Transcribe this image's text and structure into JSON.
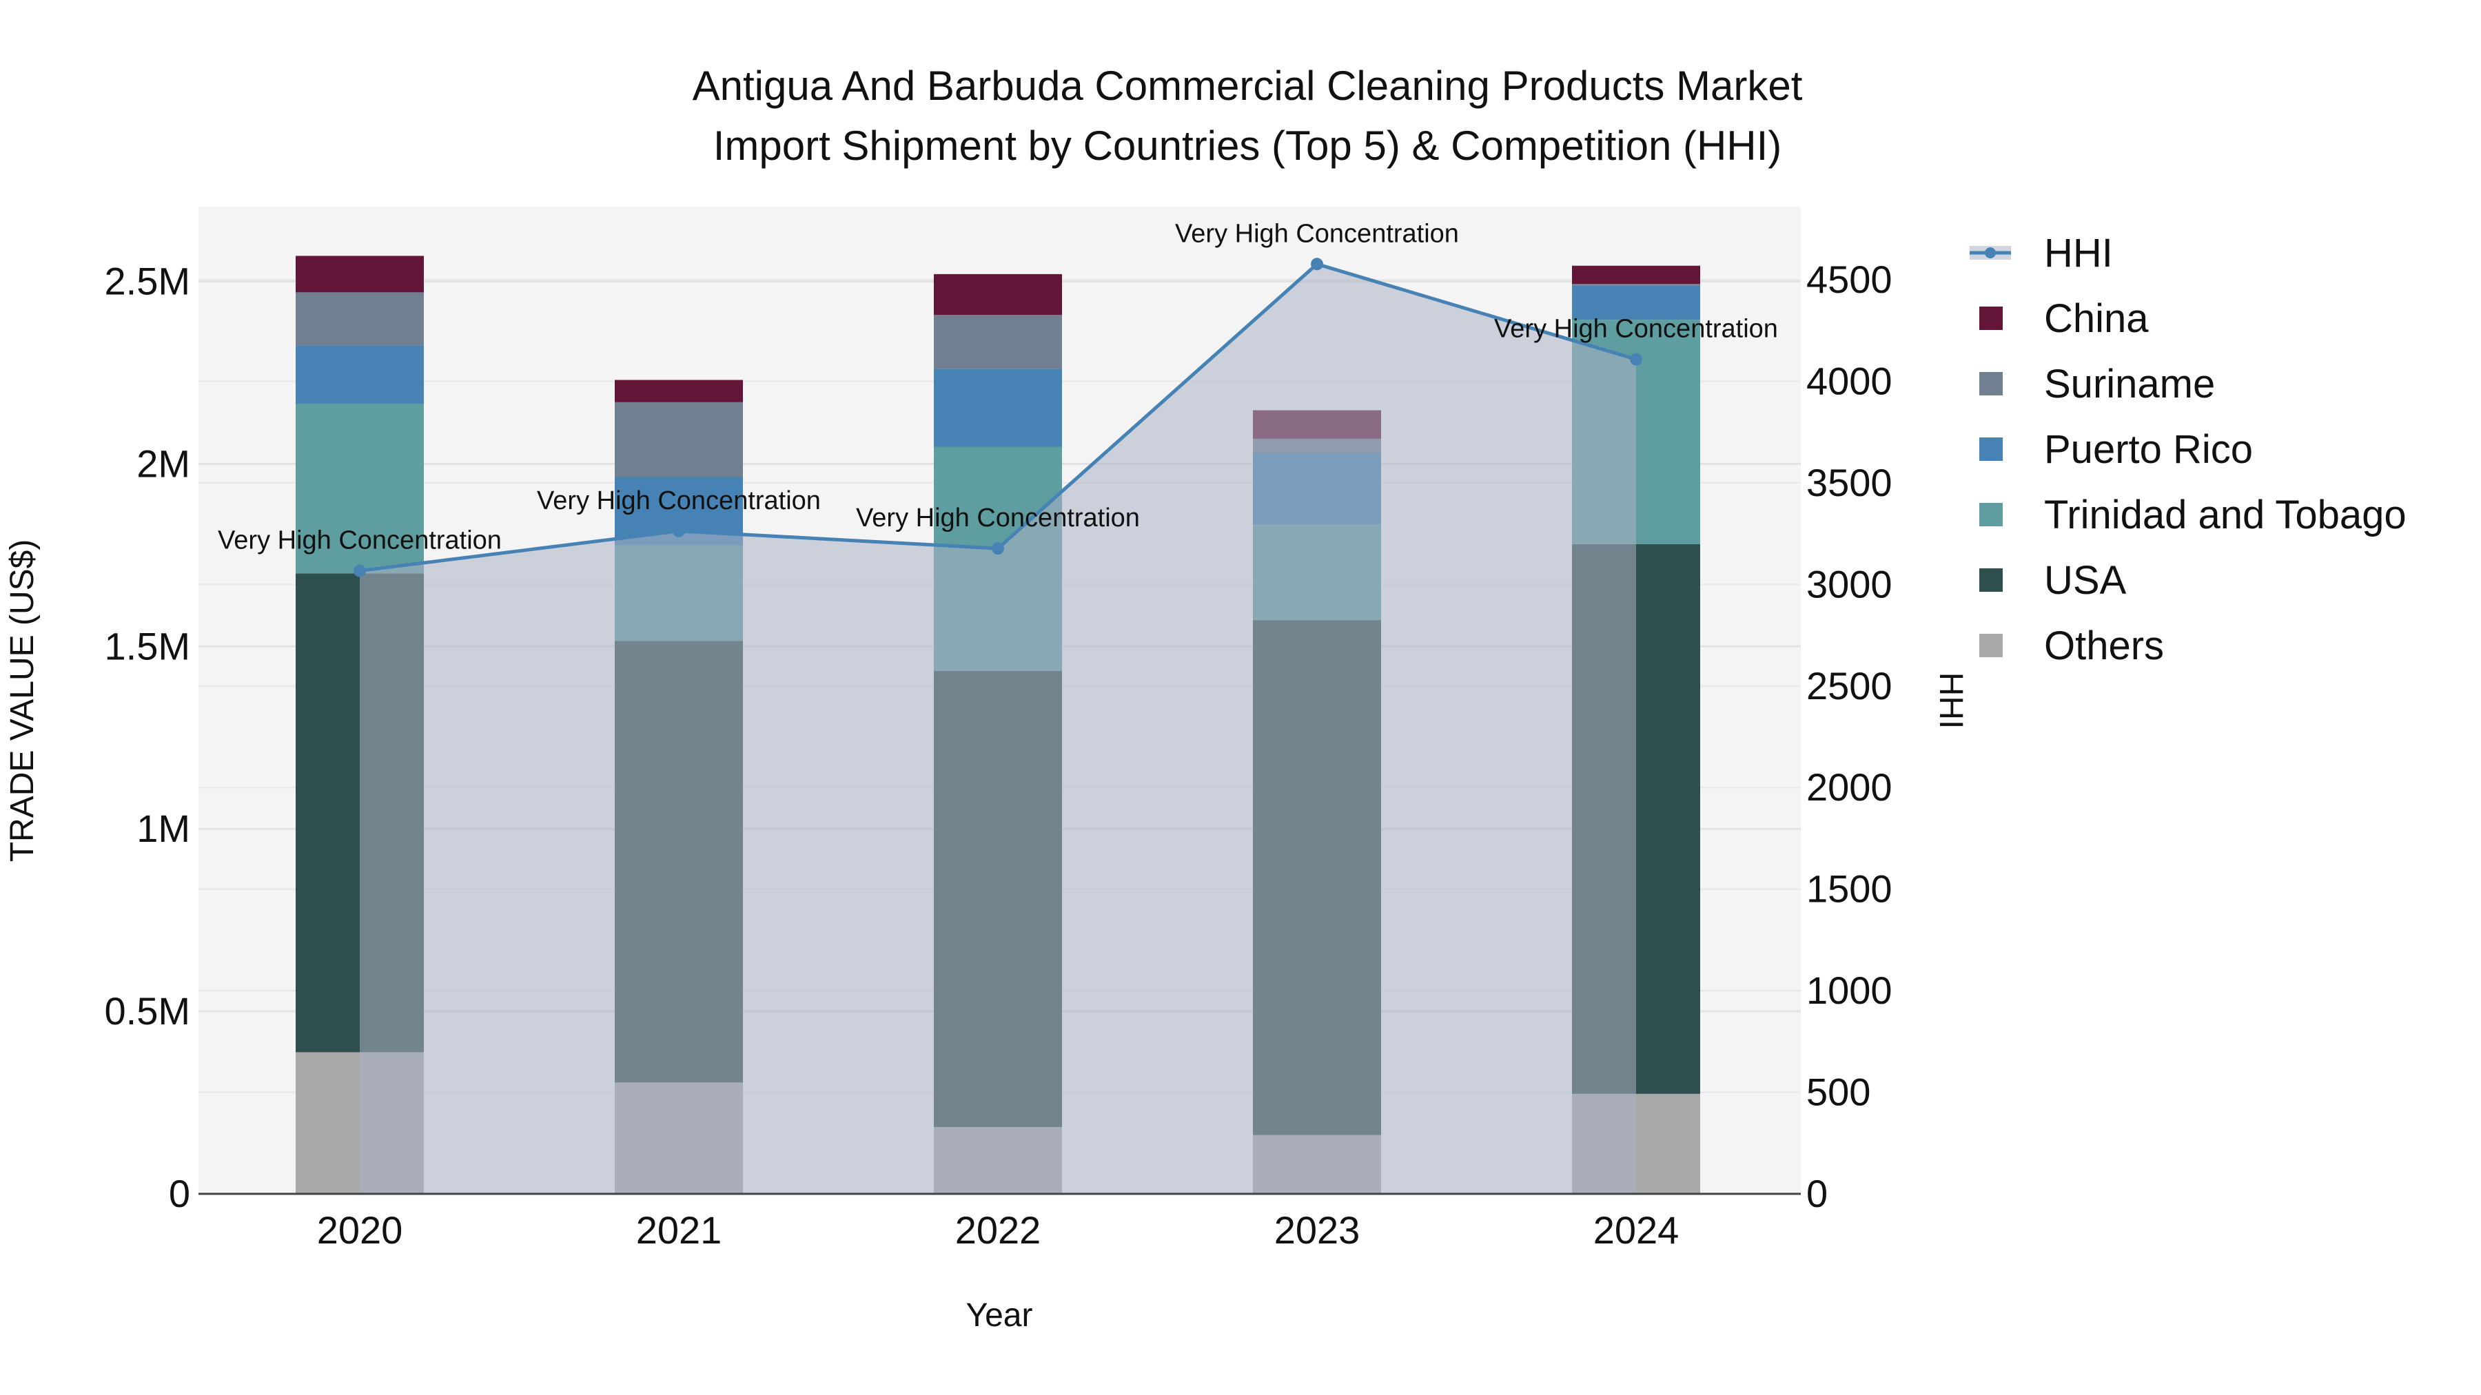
{
  "chart_data": {
    "type": "bar",
    "stacked": true,
    "title": "Antigua And Barbuda Commercial Cleaning Products Market",
    "subtitle": "Import Shipment by Countries (Top 5) & Competition (HHI)",
    "xlabel": "Year",
    "ylabel": "TRADE VALUE (US$)",
    "y2label": "HHI",
    "categories": [
      "2020",
      "2021",
      "2022",
      "2023",
      "2024"
    ],
    "ylim": [
      0,
      2700000
    ],
    "y2lim": [
      0,
      4860
    ],
    "yticks": [
      0,
      500000,
      1000000,
      1500000,
      2000000,
      2500000
    ],
    "ytick_labels": [
      "0",
      "0.5M",
      "1M",
      "1.5M",
      "2M",
      "2.5M"
    ],
    "y2ticks": [
      0,
      500,
      1000,
      1500,
      2000,
      2500,
      3000,
      3500,
      4000,
      4500
    ],
    "y2tick_labels": [
      "0",
      "500",
      "1000",
      "1500",
      "2000",
      "2500",
      "3000",
      "3500",
      "4000",
      "4500"
    ],
    "grid": true,
    "legend_position": "right",
    "series": [
      {
        "name": "Others",
        "color": "#A9A9A9",
        "values": [
          388000,
          305000,
          183000,
          161000,
          274000
        ]
      },
      {
        "name": "USA",
        "color": "#2F4F4F",
        "values": [
          1312000,
          1210000,
          1250000,
          1411000,
          1506000
        ]
      },
      {
        "name": "Trinidad and Tobago",
        "color": "#5F9EA0",
        "values": [
          465000,
          262000,
          614000,
          262000,
          615000
        ]
      },
      {
        "name": "Puerto Rico",
        "color": "#4682B4",
        "values": [
          160000,
          187000,
          213000,
          196000,
          93000
        ]
      },
      {
        "name": "Suriname",
        "color": "#708090",
        "values": [
          145000,
          205000,
          148000,
          39000,
          5000
        ]
      },
      {
        "name": "China",
        "color": "#641638",
        "values": [
          100000,
          61000,
          112000,
          78000,
          50000
        ]
      }
    ],
    "legend_order": [
      "HHI",
      "China",
      "Suriname",
      "Puerto Rico",
      "Trinidad and Tobago",
      "USA",
      "Others"
    ],
    "hhi": {
      "name": "HHI",
      "color": "#4682B4",
      "values": [
        3067,
        3263,
        3177,
        4577,
        4108
      ],
      "annotations": [
        "Very High Concentration",
        "Very High Concentration",
        "Very High Concentration",
        "Very High Concentration",
        "Very High Concentration"
      ]
    }
  }
}
